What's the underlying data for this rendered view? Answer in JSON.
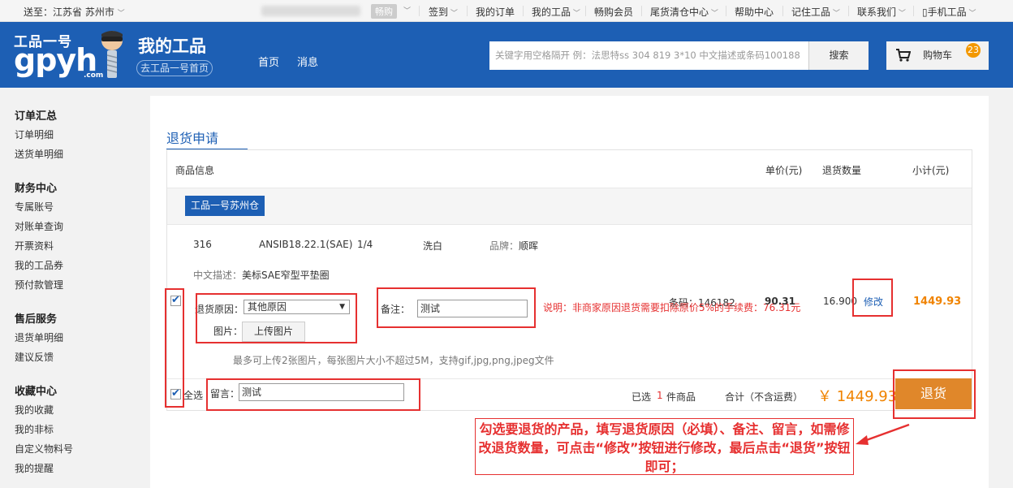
{
  "topbar": {
    "delivery_prefix": "送至：",
    "location": "江苏省 苏州市",
    "user_name": "畅购",
    "menu": [
      "签到",
      "我的订单",
      "我的工品",
      "畅购会员",
      "尾货清仓中心",
      "帮助中心",
      "记住工品",
      "联系我们",
      "手机工品"
    ]
  },
  "header": {
    "logo_cn": "工品一号",
    "logo_en": "gpyh",
    "logo_com": ".com",
    "title": "我的工品",
    "home_link": "去工品一号首页",
    "nav": [
      "首页",
      "消息"
    ],
    "search_placeholder": "关键字用空格隔开 例：法思特ss 304 819 3*10 中文描述或条码100188",
    "search_button": "搜索",
    "cart_label": "购物车",
    "cart_count": "23"
  },
  "sidebar": {
    "groups": [
      {
        "title": "订单汇总",
        "items": [
          "订单明细",
          "送货单明细"
        ]
      },
      {
        "title": "财务中心",
        "items": [
          "专属账号",
          "对账单查询",
          "开票资料",
          "我的工品券",
          "预付款管理"
        ]
      },
      {
        "title": "售后服务",
        "items": [
          "退货单明细",
          "建议反馈"
        ]
      },
      {
        "title": "收藏中心",
        "items": [
          "我的收藏",
          "我的非标",
          "自定义物料号",
          "我的提醒"
        ]
      }
    ]
  },
  "main": {
    "tab_title": "退货申请",
    "columns": {
      "product": "商品信息",
      "price": "单价(元)",
      "qty": "退货数量",
      "subtotal": "小计(元)"
    },
    "warehouse": "工品一号苏州仓",
    "item": {
      "material": "316",
      "standard": "ANSIB18.22.1(SAE)",
      "size": "1/4",
      "finish": "洗白",
      "brand_label": "品牌：",
      "brand": "顺晖",
      "desc_label": "中文描述：",
      "desc": "美标SAE窄型平垫圈",
      "reason_label": "退货原因：",
      "reason_value": "其他原因",
      "image_label": "图片：",
      "upload_button": "上传图片",
      "upload_hint": "最多可上传2张图片，每张图片大小不超过5M，支持gif,jpg,png,jpeg文件",
      "remark_label": "备注：",
      "remark_value": "测试",
      "notice": "说明：非商家原因退货需要扣除原价5%的手续费：76.31元",
      "barcode": "条码：146182",
      "price": "90.31",
      "qty": "16.900",
      "modify": "修改",
      "subtotal": "1449.93"
    },
    "footer": {
      "select_all": "全选",
      "message_label": "留言：",
      "message_value": "测试",
      "selected_prefix": "已选",
      "selected_count": "1",
      "selected_suffix": "件商品",
      "total_label": "合计（不含运费）",
      "total_value": "￥ 1449.93",
      "submit": "退货"
    },
    "callout": "勾选要退货的产品，填写退货原因（必填）、备注、留言，如需修改退货数量，可点击“修改”按钮进行修改，最后点击“退货”按钮即可；"
  }
}
